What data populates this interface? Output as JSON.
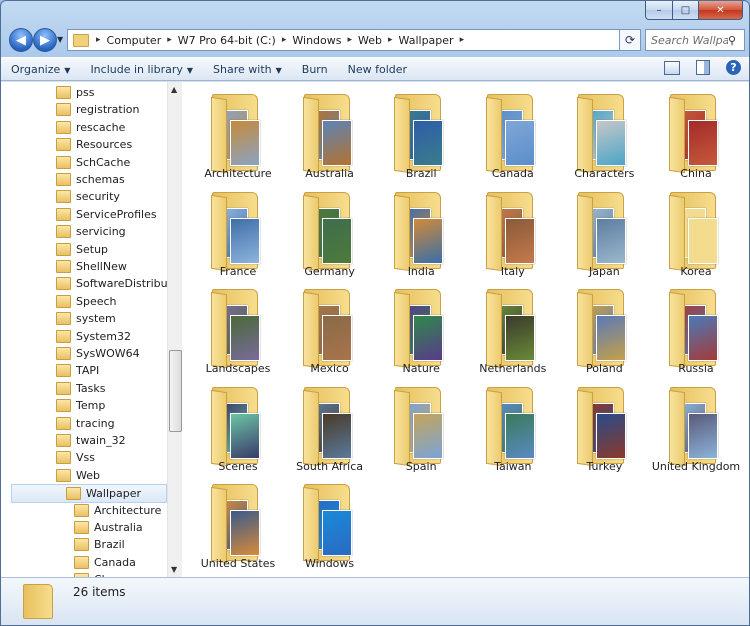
{
  "window": {
    "min_label": "–",
    "max_label": "□",
    "close_label": "✕"
  },
  "nav": {
    "back_icon": "back-arrow",
    "forward_icon": "forward-arrow",
    "breadcrumbs": [
      "Computer",
      "W7 Pro 64-bit (C:)",
      "Windows",
      "Web",
      "Wallpaper"
    ],
    "search_placeholder": "Search Wallpa..."
  },
  "toolbar": {
    "organize": "Organize",
    "include_in_library": "Include in library",
    "share_with": "Share with",
    "burn": "Burn",
    "new_folder": "New folder"
  },
  "tree": {
    "items": [
      "pss",
      "registration",
      "rescache",
      "Resources",
      "SchCache",
      "schemas",
      "security",
      "ServiceProfiles",
      "servicing",
      "Setup",
      "ShellNew",
      "SoftwareDistribution",
      "Speech",
      "system",
      "System32",
      "SysWOW64",
      "TAPI",
      "Tasks",
      "Temp",
      "tracing",
      "twain_32",
      "Vss",
      "Web"
    ],
    "selected": "Wallpaper",
    "children": [
      "Architecture",
      "Australia",
      "Brazil",
      "Canada",
      "Ch..."
    ]
  },
  "folders": [
    {
      "name": "Architecture",
      "c1": "#8aa3c4",
      "c2": "#c58a3a"
    },
    {
      "name": "Australia",
      "c1": "#b5722f",
      "c2": "#5c84b7"
    },
    {
      "name": "Brazil",
      "c1": "#3a7c8c",
      "c2": "#2d5ea8"
    },
    {
      "name": "Canada",
      "c1": "#5a8fc9",
      "c2": "#7fa6d8"
    },
    {
      "name": "Characters",
      "c1": "#4aa5c8",
      "c2": "#c7c7c7"
    },
    {
      "name": "China",
      "c1": "#c45a3a",
      "c2": "#a52a2a"
    },
    {
      "name": "France",
      "c1": "#8fb4dd",
      "c2": "#3f6fa8"
    },
    {
      "name": "Germany",
      "c1": "#4e7a3a",
      "c2": "#3e6e4e"
    },
    {
      "name": "India",
      "c1": "#3a6ea8",
      "c2": "#d18a3a"
    },
    {
      "name": "Italy",
      "c1": "#c47a4a",
      "c2": "#8a5a3a"
    },
    {
      "name": "Japan",
      "c1": "#9bb8cc",
      "c2": "#5d7da0"
    },
    {
      "name": "Korea",
      "c1": "#f4dc8e",
      "c2": "#f4dc8e"
    },
    {
      "name": "Landscapes",
      "c1": "#7a6a9a",
      "c2": "#4a6a3a"
    },
    {
      "name": "Mexico",
      "c1": "#a8744a",
      "c2": "#8a6a4a"
    },
    {
      "name": "Nature",
      "c1": "#5a3a8a",
      "c2": "#2e8a4a"
    },
    {
      "name": "Netherlands",
      "c1": "#6a8a3a",
      "c2": "#3a3a2a"
    },
    {
      "name": "Poland",
      "c1": "#c4a04a",
      "c2": "#5a7ab8"
    },
    {
      "name": "Russia",
      "c1": "#a53a3a",
      "c2": "#4a7ab8"
    },
    {
      "name": "Scenes",
      "c1": "#3a3a6a",
      "c2": "#6ac4a5"
    },
    {
      "name": "South Africa",
      "c1": "#5a7a9a",
      "c2": "#4a3a2a"
    },
    {
      "name": "Spain",
      "c1": "#7aa4d8",
      "c2": "#c4a45a"
    },
    {
      "name": "Taiwan",
      "c1": "#5a8ac4",
      "c2": "#3a7a5a"
    },
    {
      "name": "Turkey",
      "c1": "#8a3a2a",
      "c2": "#2a4a8a"
    },
    {
      "name": "United Kingdom",
      "c1": "#8ab4d8",
      "c2": "#5a5a7a"
    },
    {
      "name": "United States",
      "c1": "#d88a3a",
      "c2": "#3a5a8a"
    },
    {
      "name": "Windows",
      "c1": "#2a6ac4",
      "c2": "#1a8ad8"
    }
  ],
  "status": {
    "count": "26 items"
  }
}
